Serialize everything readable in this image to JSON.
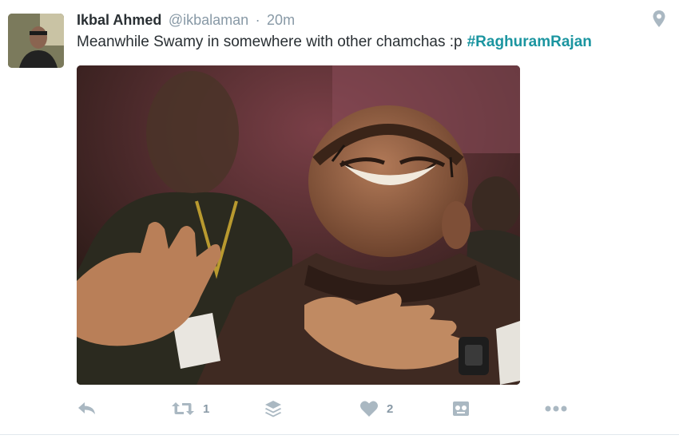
{
  "tweet": {
    "author_name": "Ikbal Ahmed",
    "handle": "@ikbalaman",
    "separator": "·",
    "time": "20m",
    "text": "Meanwhile Swamy in somewhere with other chamchas :p",
    "hashtag": "#RaghuramRajan"
  },
  "actions": {
    "retweet_count": "1",
    "like_count": "2"
  },
  "icons": [
    "geo-pin-icon",
    "reply-icon",
    "retweet-icon",
    "layers-icon",
    "heart-icon",
    "gif-icon",
    "more-icon"
  ],
  "colors": {
    "name": "#292f33",
    "muted": "#8899a6",
    "hashtag": "#1b95a0",
    "icon": "#aab8c2"
  }
}
